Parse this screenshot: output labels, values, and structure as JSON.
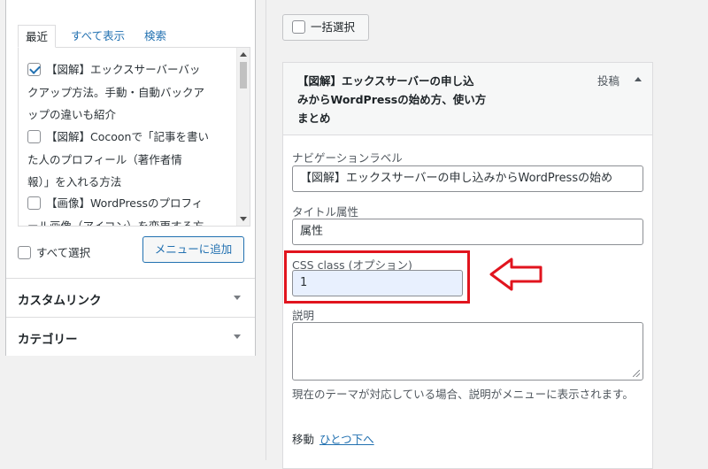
{
  "left": {
    "tabs": [
      "最近",
      "すべて表示",
      "検索"
    ],
    "posts": [
      {
        "lines": [
          "【図解】エックスサーバーバッ",
          "クアップ方法。手動・自動バックア",
          "ップの違いも紹介"
        ],
        "checked": true
      },
      {
        "lines": [
          "【図解】Cocoonで「記事を書い",
          "た人のプロフィール（著作者情",
          "報）」を入れる方法"
        ],
        "checked": false
      },
      {
        "lines": [
          "【画像】WordPressのプロフィ",
          "ール画像（アイコン）を変更する方"
        ],
        "checked": false
      }
    ],
    "select_all": "すべて選択",
    "add_to_menu": "メニューに追加",
    "accordions": [
      "カスタムリンク",
      "カテゴリー"
    ]
  },
  "right": {
    "bulk_select": "一括選択",
    "item_title_lines": [
      "【図解】エックスサーバーの申し込",
      "みからWordPressの始め方、使い方",
      "まとめ"
    ],
    "item_type": "投稿",
    "nav_label": "ナビゲーションラベル",
    "nav_value": "【図解】エックスサーバーの申し込みからWordPressの始め",
    "title_attr_label": "タイトル属性",
    "title_attr_value": "属性",
    "css_label": "CSS class (オプション)",
    "css_value": "1",
    "desc_label": "説明",
    "desc_note": "現在のテーマが対応している場合、説明がメニューに表示されます。",
    "move_label": "移動",
    "move_link": "ひとつ下へ"
  },
  "colors": {
    "accent": "#2271b1",
    "highlight_red": "#e1141e"
  }
}
